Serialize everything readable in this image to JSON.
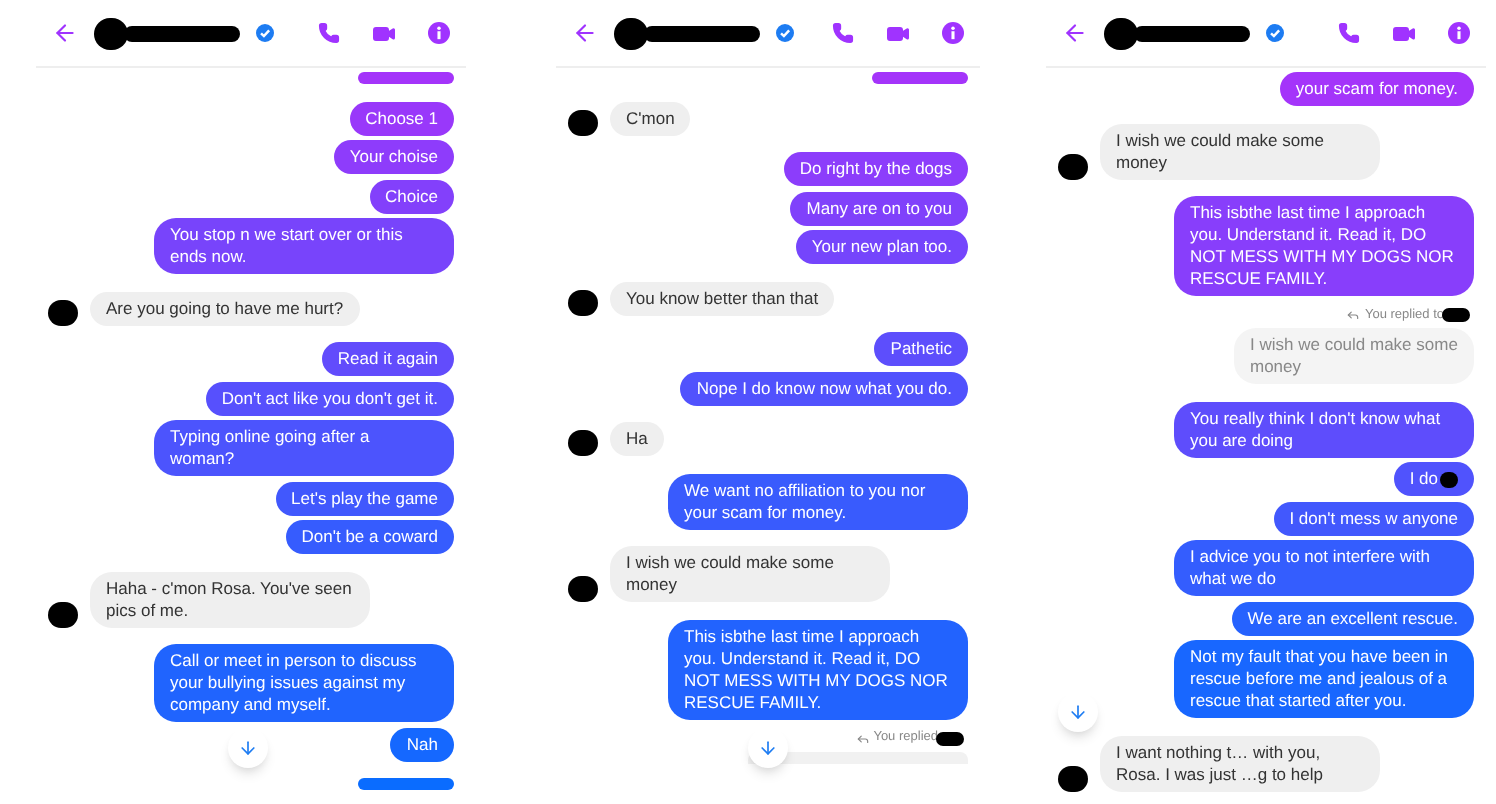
{
  "screens": [
    {
      "header": {
        "verified": true
      },
      "scroll_down": true,
      "messages": [
        {
          "kind": "partial_out"
        },
        {
          "kind": "out",
          "text": "Choose 1"
        },
        {
          "kind": "out",
          "text": "Your choise"
        },
        {
          "kind": "out",
          "text": "Choice"
        },
        {
          "kind": "out",
          "text": "You stop n we start over or this ends now."
        },
        {
          "kind": "in",
          "text": "Are you going to have me hurt?"
        },
        {
          "kind": "out",
          "text": "Read it again"
        },
        {
          "kind": "out",
          "text": "Don't act like you don't get it."
        },
        {
          "kind": "out",
          "text": "Typing online going after a woman?"
        },
        {
          "kind": "out",
          "text": "Let's play the game"
        },
        {
          "kind": "out",
          "text": "Don't be a coward"
        },
        {
          "kind": "in",
          "text": "Haha - c'mon Rosa. You've seen pics of me."
        },
        {
          "kind": "out",
          "text": "Call or meet in person to discuss your bullying issues against my company and myself."
        },
        {
          "kind": "out",
          "text": "Nah"
        },
        {
          "kind": "partial_out"
        }
      ]
    },
    {
      "header": {
        "verified": true
      },
      "scroll_down": true,
      "messages": [
        {
          "kind": "partial_out"
        },
        {
          "kind": "in",
          "text": "C'mon"
        },
        {
          "kind": "out",
          "text": "Do right by the dogs"
        },
        {
          "kind": "out",
          "text": "Many are on to you"
        },
        {
          "kind": "out",
          "text": "Your new plan too."
        },
        {
          "kind": "in",
          "text": "You know better than that"
        },
        {
          "kind": "out",
          "text": "Pathetic"
        },
        {
          "kind": "out",
          "text": "Nope I do know now what you do."
        },
        {
          "kind": "in",
          "text": "Ha"
        },
        {
          "kind": "out",
          "text": "We want no affiliation to you nor your scam for money."
        },
        {
          "kind": "in",
          "text": "I wish we could make some money"
        },
        {
          "kind": "out",
          "text": "This isbthe last time I approach you. Understand it. Read it, DO NOT MESS WITH MY DOGS NOR RESCUE FAMILY."
        },
        {
          "kind": "reply_note",
          "text": "You replied"
        },
        {
          "kind": "partial_quote"
        }
      ]
    },
    {
      "header": {
        "verified": true
      },
      "scroll_down": true,
      "messages": [
        {
          "kind": "out",
          "text": "your scam for money."
        },
        {
          "kind": "in",
          "text": "I wish we could make some money"
        },
        {
          "kind": "out",
          "text": "This isbthe last time I approach you. Understand it. Read it, DO NOT MESS WITH MY DOGS NOR RESCUE FAMILY."
        },
        {
          "kind": "reply_note",
          "text": "You replied to"
        },
        {
          "kind": "quote",
          "text": "I wish we could make some money"
        },
        {
          "kind": "out",
          "text": "You really think I don't know what you are doing"
        },
        {
          "kind": "out",
          "text": "I do",
          "redacted": true
        },
        {
          "kind": "out",
          "text": "I don't mess w anyone"
        },
        {
          "kind": "out",
          "text": "I advice you to not interfere with what we do"
        },
        {
          "kind": "out",
          "text": "We are an excellent rescue."
        },
        {
          "kind": "out",
          "text": "Not my fault that you have been in rescue before me and jealous of a rescue that started after you."
        },
        {
          "kind": "in",
          "text": "I want nothing t… with you, Rosa. I was just …g to help"
        }
      ]
    }
  ]
}
